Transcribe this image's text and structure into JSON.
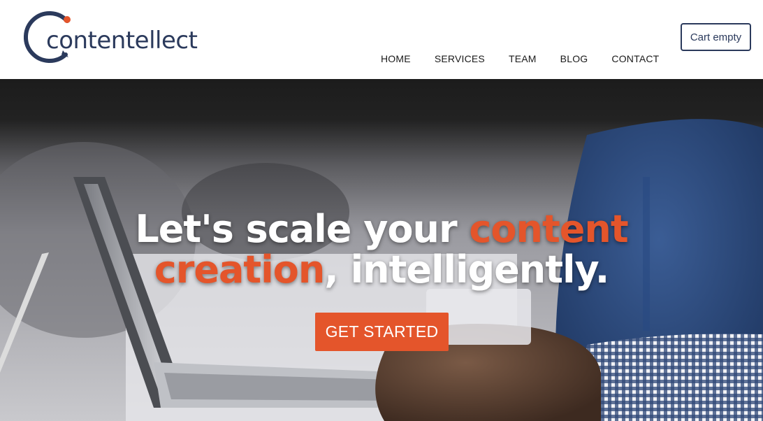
{
  "brand": {
    "name": "contentellect",
    "primary_color": "#2b3a5c",
    "accent_color": "#e4552b"
  },
  "nav": {
    "items": [
      {
        "label": "HOME"
      },
      {
        "label": "SERVICES"
      },
      {
        "label": "TEAM"
      },
      {
        "label": "BLOG"
      },
      {
        "label": "CONTACT"
      }
    ]
  },
  "cart": {
    "label": "Cart empty"
  },
  "hero": {
    "heading_part1": "Let's scale your ",
    "heading_accent1": "content",
    "heading_accent2": "creation",
    "heading_part2": ", intelligently.",
    "cta_label": "GET STARTED",
    "background": "laptop-desk-photo"
  }
}
